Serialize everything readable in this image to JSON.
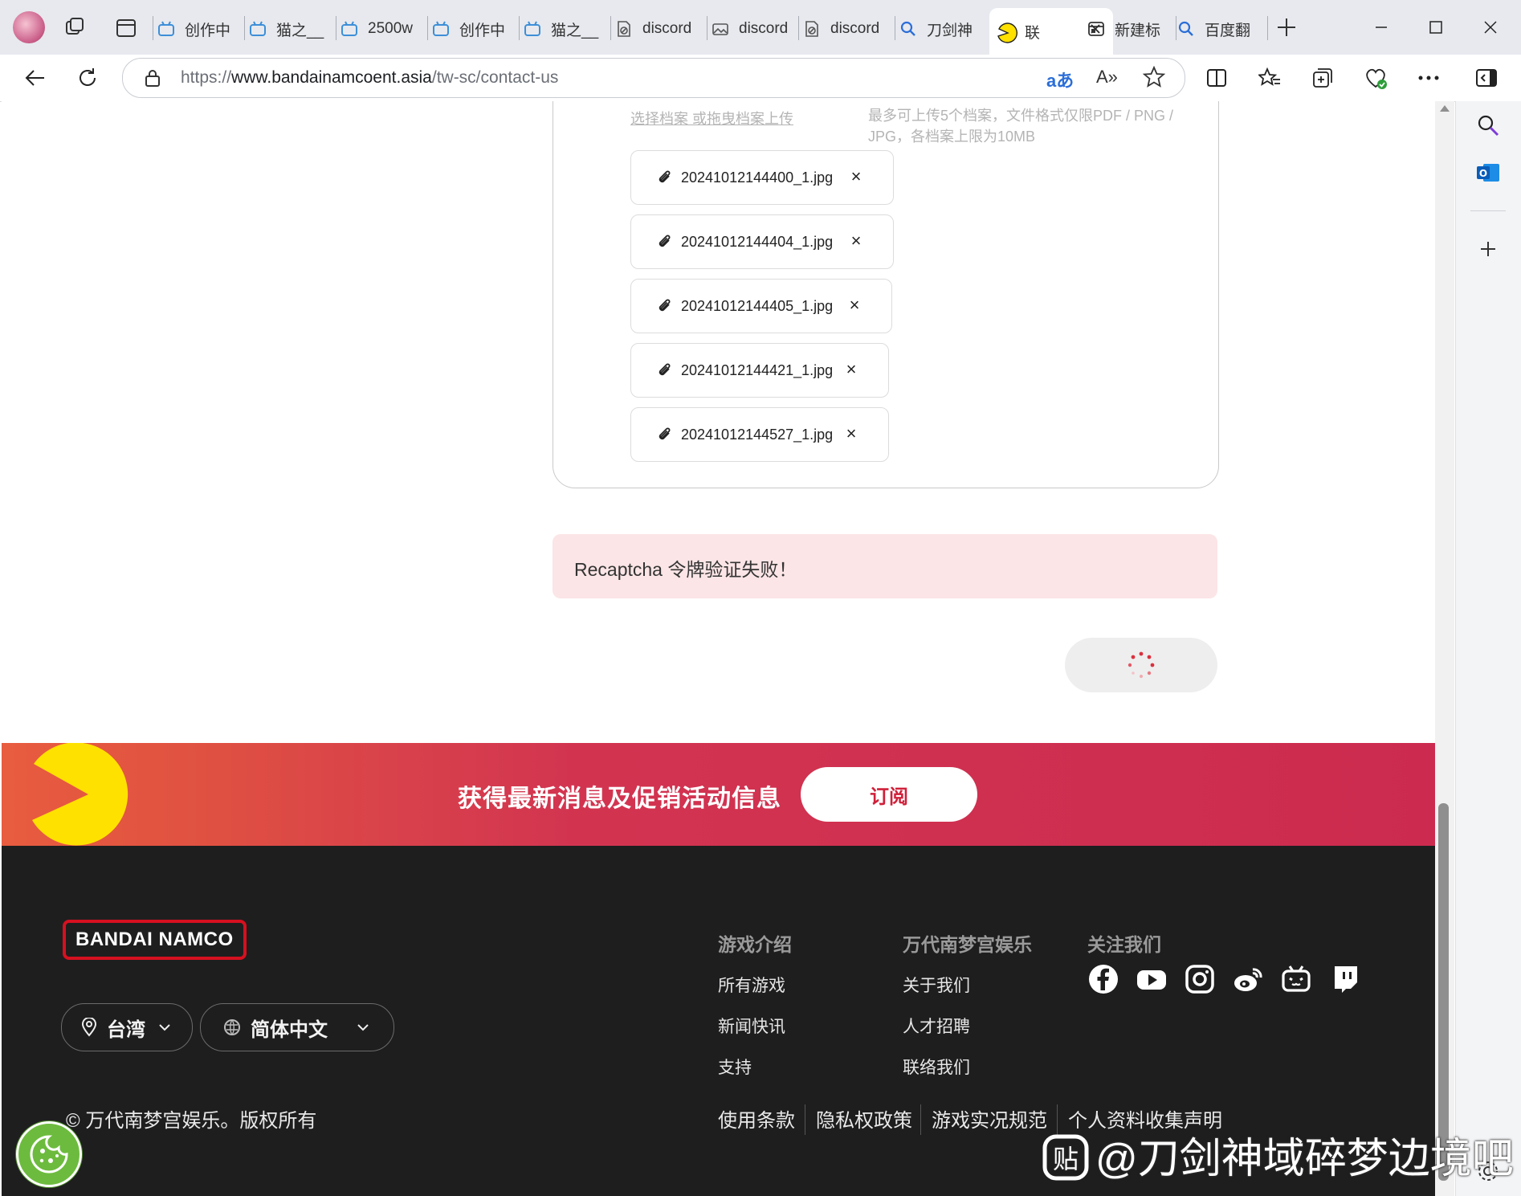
{
  "tabs": [
    {
      "label": "创作中",
      "icon": "bilibili-icon"
    },
    {
      "label": "猫之__",
      "icon": "bilibili-icon"
    },
    {
      "label": "2500w",
      "icon": "bilibili-icon"
    },
    {
      "label": "创作中",
      "icon": "bilibili-icon"
    },
    {
      "label": "猫之__",
      "icon": "bilibili-icon"
    },
    {
      "label": "discord",
      "icon": "blocked-page-icon"
    },
    {
      "label": "discord",
      "icon": "broken-image-icon"
    },
    {
      "label": "discord",
      "icon": "blocked-page-icon"
    },
    {
      "label": "刀剑神",
      "icon": "search-icon"
    },
    {
      "label": "联",
      "icon": "pacman-icon",
      "active": true
    },
    {
      "label": "新建标",
      "icon": "new-tab-icon"
    },
    {
      "label": "百度翻",
      "icon": "search-icon"
    }
  ],
  "address_bar": {
    "url_prefix": "https://",
    "url_host": "www.bandainamcoent.asia",
    "url_path": "/tw-sc/contact-us"
  },
  "upload": {
    "hint_left": "选择档案 或拖曳档案上传",
    "hint_right_line1": "最多可上传5个档案，文件格式仅限PDF / PNG /",
    "hint_right_line2": "JPG，各档案上限为10MB",
    "files": [
      "20241012144400_1.jpg",
      "20241012144404_1.jpg",
      "20241012144405_1.jpg",
      "20241012144421_1.jpg",
      "20241012144527_1.jpg"
    ],
    "remove_glyph": "×"
  },
  "error_message": "Recaptcha 令牌验证失败！",
  "newsletter": {
    "text": "获得最新消息及促销活动信息",
    "button": "订阅"
  },
  "footer": {
    "brand": "BANDAI NAMCO",
    "region": "台湾",
    "language": "简体中文",
    "columns": [
      {
        "heading": "游戏介绍",
        "links": [
          "所有游戏",
          "新闻快讯",
          "支持"
        ]
      },
      {
        "heading": "万代南梦宫娱乐",
        "links": [
          "关于我们",
          "人才招聘",
          "联络我们"
        ]
      }
    ],
    "social_heading": "关注我们",
    "social_icons": [
      "facebook-icon",
      "youtube-icon",
      "instagram-icon",
      "weibo-icon",
      "bilibili-icon",
      "twitch-icon"
    ],
    "copyright": "© 万代南梦宫娱乐。版权所有",
    "legal_links": [
      "使用条款",
      "隐私权政策",
      "游戏实况规范",
      "个人资料收集声明"
    ]
  },
  "watermark": "@刀剑神域碎梦边境吧",
  "colors": {
    "brand_red": "#d6101f",
    "error_bg": "#fbe5e6",
    "footer_bg": "#1e1e1f",
    "newsletter_start": "#e85c3f",
    "newsletter_end": "#cc2b4f",
    "pacman_yellow": "#ffe100"
  }
}
